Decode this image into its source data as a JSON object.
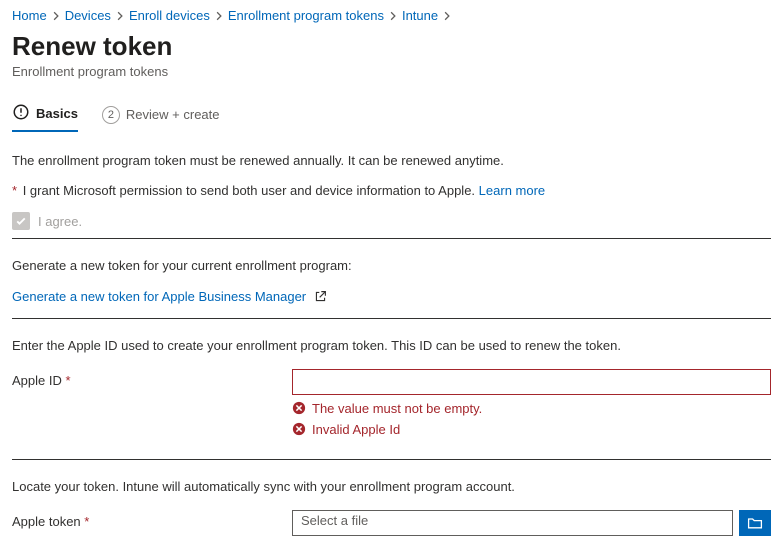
{
  "breadcrumb": {
    "items": [
      "Home",
      "Devices",
      "Enroll devices",
      "Enrollment program tokens",
      "Intune"
    ]
  },
  "header": {
    "title": "Renew token",
    "subtitle": "Enrollment program tokens"
  },
  "tabs": {
    "basics": "Basics",
    "review_num": "2",
    "review": "Review + create"
  },
  "body": {
    "intro": "The enrollment program token must be renewed annually. It can be renewed anytime.",
    "consent_text": "I grant Microsoft permission to send both user and device information to Apple.",
    "learn_more": "Learn more",
    "agree_label": "I agree.",
    "generate_heading": "Generate a new token for your current enrollment program:",
    "generate_link": "Generate a new token for Apple Business Manager",
    "apple_id_intro": "Enter the Apple ID used to create your enrollment program token. This ID can be used to renew the token.",
    "apple_id_label": "Apple ID",
    "apple_id_value": "",
    "err_empty": "The value must not be empty.",
    "err_invalid": "Invalid Apple Id",
    "token_intro": "Locate your token. Intune will automatically sync with your enrollment program account.",
    "token_label": "Apple token",
    "file_placeholder": "Select a file"
  }
}
